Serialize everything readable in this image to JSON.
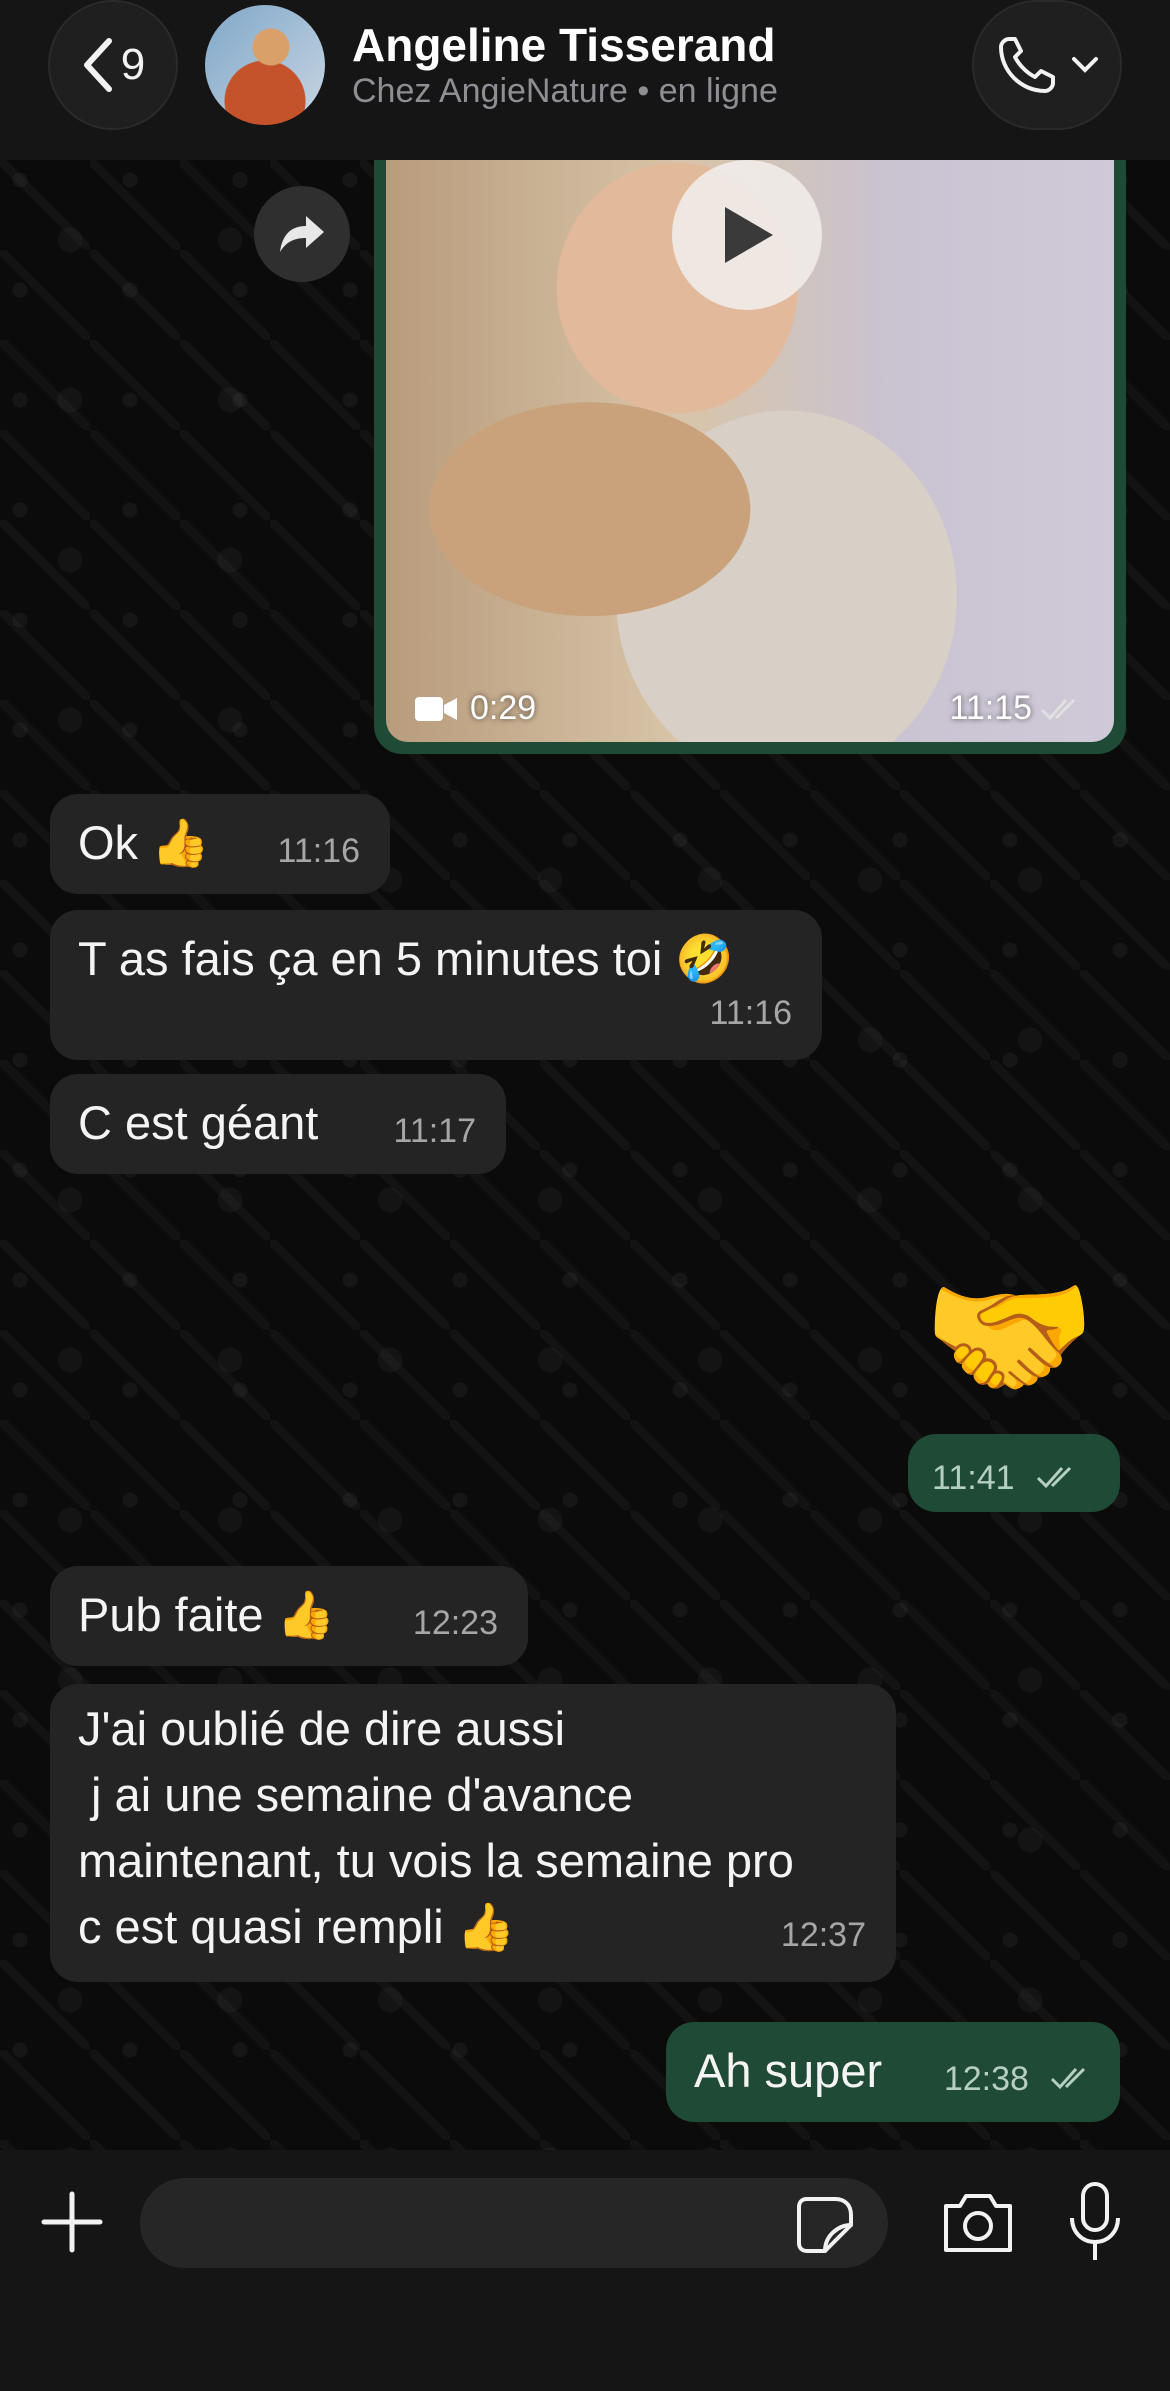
{
  "header": {
    "back_count": "9",
    "contact_name": "Angeline Tisserand",
    "contact_status": "Chez AngieNature  • en ligne"
  },
  "messages": [
    {
      "type": "video",
      "direction": "out",
      "duration": "0:29",
      "time": "11:15"
    },
    {
      "direction": "in",
      "text": "Ok 👍",
      "time": "11:16"
    },
    {
      "direction": "in",
      "text": "T as fais ça en 5 minutes toi 🤣",
      "time": "11:16"
    },
    {
      "direction": "in",
      "text": "C est géant",
      "time": "11:17"
    },
    {
      "direction": "out",
      "emoji": "🤝",
      "time": "11:41"
    },
    {
      "direction": "in",
      "text": "Pub faite 👍",
      "time": "12:23"
    },
    {
      "direction": "in",
      "lines": [
        "J'ai oublié de dire aussi",
        " j ai une semaine d'avance",
        "maintenant, tu vois la semaine pro",
        "c est quasi rempli 👍"
      ],
      "time": "12:37"
    },
    {
      "direction": "out",
      "text": "Ah super",
      "time": "12:38"
    }
  ],
  "composer": {
    "placeholder": ""
  },
  "colors": {
    "outgoing_bubble": "#1e4a36",
    "incoming_bubble": "#242424",
    "background": "#0b0b0b"
  }
}
